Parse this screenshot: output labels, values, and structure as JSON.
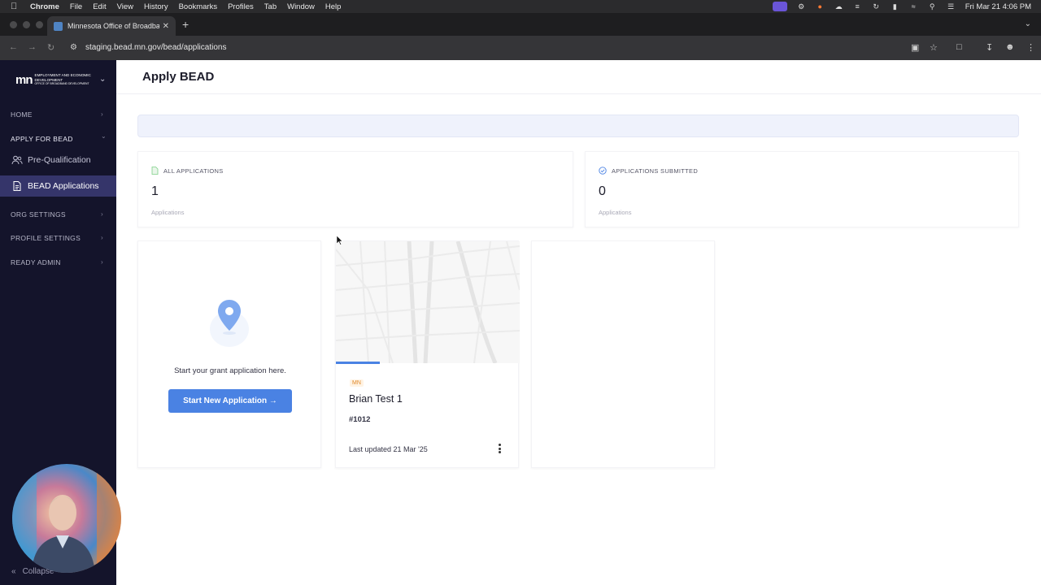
{
  "menubar": {
    "apple": "",
    "items": [
      "Chrome",
      "File",
      "Edit",
      "View",
      "History",
      "Bookmarks",
      "Profiles",
      "Tab",
      "Window",
      "Help"
    ],
    "clock": "Fri Mar 21  4:06 PM"
  },
  "browser": {
    "tab_title": "Minnesota Office of Broadband",
    "url": "staging.bead.mn.gov/bead/applications"
  },
  "sidebar": {
    "logo_mark": "mn",
    "logo_text": "EMPLOYMENT AND ECONOMIC DEVELOPMENT",
    "logo_subtext": "OFFICE OF BROADBAND DEVELOPMENT",
    "sections": {
      "home": "HOME",
      "apply": "APPLY FOR BEAD",
      "org": "ORG SETTINGS",
      "profile": "PROFILE SETTINGS",
      "ready": "READY ADMIN"
    },
    "subitems": {
      "prequal": "Pre-Qualification",
      "applications": "BEAD Applications"
    },
    "collapse": "Collapse"
  },
  "main": {
    "page_title": "Apply BEAD",
    "stats": [
      {
        "label": "ALL APPLICATIONS",
        "value": "1",
        "sub": "Applications"
      },
      {
        "label": "APPLICATIONS SUBMITTED",
        "value": "0",
        "sub": "Applications"
      }
    ],
    "start_card": {
      "text": "Start your grant application here.",
      "button": "Start New Application →"
    },
    "app_card": {
      "badge": "MN",
      "title": "Brian Test 1",
      "id": "#1012",
      "updated": "Last updated 21 Mar '25",
      "progress": 0.24
    }
  },
  "colors": {
    "sidebar_bg": "#14142b",
    "sidebar_selected": "#35356a",
    "accent": "#4a82e3",
    "badge": "#e08a2c"
  }
}
